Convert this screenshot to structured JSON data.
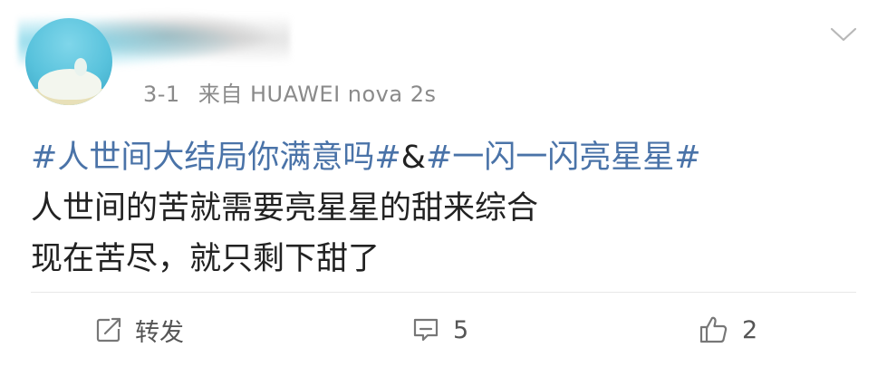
{
  "header": {
    "date": "3-1",
    "source": "来自 HUAWEI nova 2s"
  },
  "post": {
    "hashtag_1": "#人世间大结局你满意吗#",
    "ampersand": "&",
    "hashtag_2": "#一闪一闪亮星星#",
    "line_2": "人世间的苦就需要亮星星的甜来综合",
    "line_3": "现在苦尽，就只剩下甜了"
  },
  "actions": {
    "repost_label": "转发",
    "comment_count": "5",
    "like_count": "2"
  },
  "icons": {
    "expand": "chevron-down-icon",
    "repost": "repost-icon",
    "comment": "comment-icon",
    "like": "thumbs-up-icon"
  },
  "colors": {
    "hashtag": "#4a73a8",
    "meta_text": "#8a8a8a",
    "action_text": "#555555"
  }
}
